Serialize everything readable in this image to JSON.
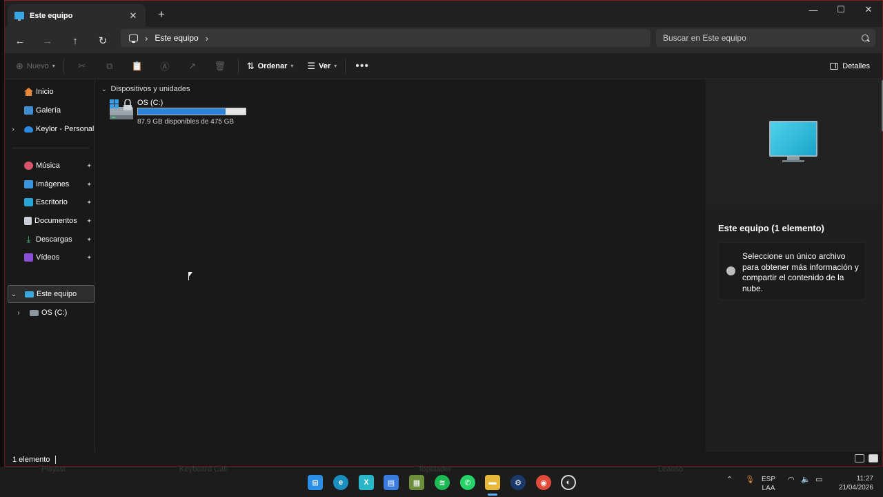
{
  "window": {
    "tab_title": "Este equipo",
    "new_tab": "+",
    "close": "✕",
    "minimize": "—",
    "maximize": "☐",
    "close_window": "✕"
  },
  "addressbar": {
    "back": "←",
    "forward": "→",
    "up": "↑",
    "refresh": "↻",
    "breadcrumb": "Este equipo",
    "separator": "›",
    "search_placeholder": "Buscar en Este equipo"
  },
  "command_bar": {
    "new_label": "Nuevo",
    "sort_label": "Ordenar",
    "view_label": "Ver",
    "more": "•••",
    "details_label": "Detalles"
  },
  "sidebar": {
    "home": "Inicio",
    "gallery": "Galería",
    "onedrive": "Keylor - Personal",
    "music": "Música",
    "pictures": "Imágenes",
    "desktop": "Escritorio",
    "documents": "Documentos",
    "downloads": "Descargas",
    "videos": "Vídeos",
    "this_pc": "Este equipo",
    "drive_c": "OS (C:)",
    "pin": "📌"
  },
  "content": {
    "group_title": "Dispositivos y unidades",
    "drive": {
      "name": "OS (C:)",
      "used_fraction": 0.815,
      "free_text": "87.9 GB disponibles de 475 GB"
    }
  },
  "details": {
    "title": "Este equipo (1 elemento)",
    "info_text": "Seleccione un único archivo para obtener más información y compartir el contenido de la nube."
  },
  "statusbar": {
    "count": "1 elemento"
  },
  "taskbar": {
    "ghost_items": [
      "Playlist",
      "Keyboard Call",
      "Topblader",
      "Leaoso"
    ],
    "ime_lang": "ESP",
    "ime_layout": "LAA",
    "time": "11:27",
    "date": "21/04/2026"
  },
  "colors": {
    "window_bg": "#191919",
    "accent": "#2a83d6",
    "border_accent": "#8a2020"
  }
}
